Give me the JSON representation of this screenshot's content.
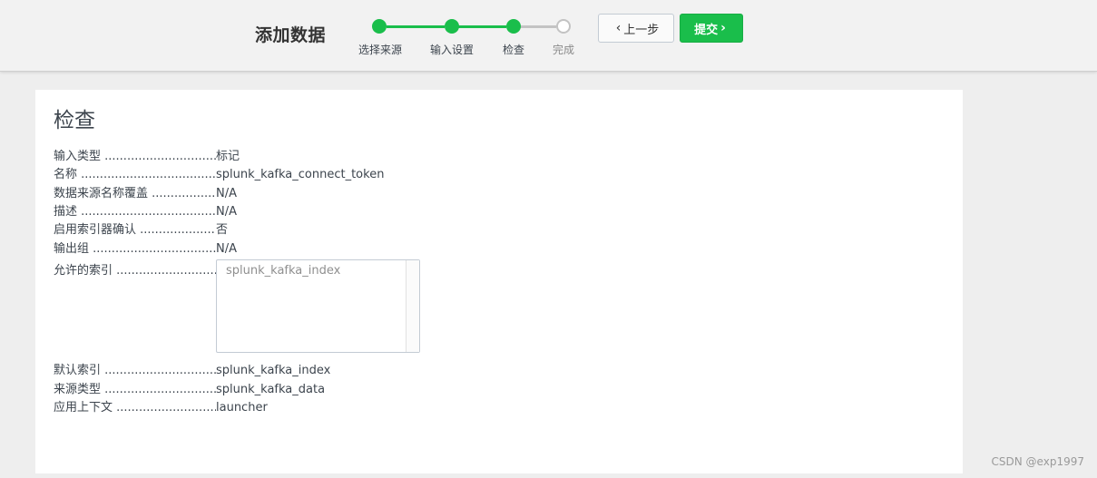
{
  "header": {
    "title": "添加数据",
    "steps": [
      {
        "label": "选择来源",
        "state": "done"
      },
      {
        "label": "输入设置",
        "state": "done"
      },
      {
        "label": "检查",
        "state": "done"
      },
      {
        "label": "完成",
        "state": "todo"
      }
    ],
    "back_label": "上一步",
    "submit_label": "提交",
    "accent_color": "#1abe4b"
  },
  "review": {
    "title": "检查",
    "rows": [
      {
        "key": "输入类型",
        "value": "标记"
      },
      {
        "key": "名称",
        "value": "splunk_kafka_connect_token"
      },
      {
        "key": "数据来源名称覆盖",
        "value": "N/A"
      },
      {
        "key": "描述",
        "value": "N/A"
      },
      {
        "key": "启用索引器确认",
        "value": "否"
      },
      {
        "key": "输出组",
        "value": "N/A"
      },
      {
        "key": "允许的索引",
        "value": ""
      },
      {
        "key": "默认索引",
        "value": "splunk_kafka_index"
      },
      {
        "key": "来源类型",
        "value": "splunk_kafka_data"
      },
      {
        "key": "应用上下文",
        "value": "launcher"
      }
    ],
    "allowed_indexes": "splunk_kafka_index"
  },
  "watermark": "CSDN @exp1997"
}
